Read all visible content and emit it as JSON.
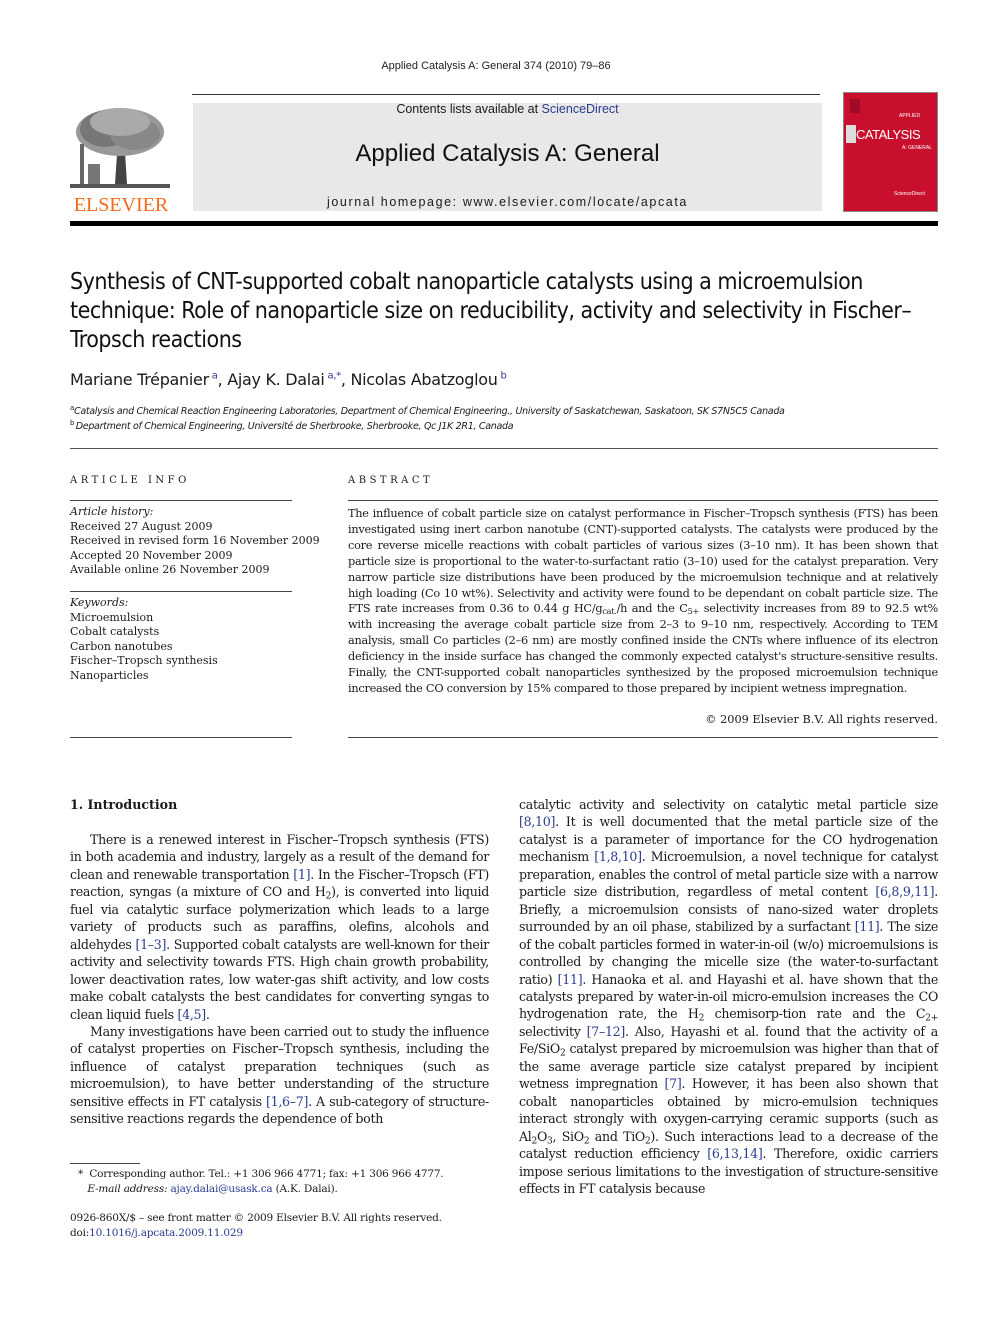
{
  "header": {
    "citation": "Applied Catalysis A: General 374 (2010) 79–86",
    "contents_prefix": "Contents lists available at ",
    "sciencedirect_link": "ScienceDirect",
    "journal_name": "Applied Catalysis A: General",
    "homepage": "journal homepage: www.elsevier.com/locate/apcata",
    "publisher_logo_text": "ELSEVIER",
    "cover_title": "CATALYSIS",
    "cover_subtitle": "APPLIED",
    "cover_sub2": "A: GENERAL",
    "cover_footer": "ScienceDirect",
    "brand_color": "#f26a1b",
    "cover_color": "#c8102e"
  },
  "article": {
    "title": "Synthesis of CNT-supported cobalt nanoparticle catalysts using a microemulsion technique: Role of nanoparticle size on reducibility, activity and selectivity in Fischer–Tropsch reactions",
    "authors": [
      {
        "name": "Mariane Trépanier",
        "sup": "a"
      },
      {
        "name": "Ajay K. Dalai",
        "sup": "a,*"
      },
      {
        "name": "Nicolas Abatzoglou",
        "sup": "b"
      }
    ],
    "affiliations": [
      {
        "sup": "a",
        "text": "Catalysis and Chemical Reaction Engineering Laboratories, Department of Chemical Engineering., University of Saskatchewan, Saskatoon, SK S7N5C5 Canada"
      },
      {
        "sup": "b",
        "text": "Department of Chemical Engineering, Université de Sherbrooke, Sherbrooke, Qc J1K 2R1, Canada"
      }
    ]
  },
  "article_info": {
    "label": "ARTICLE INFO",
    "history_label": "Article history:",
    "history": [
      "Received 27 August 2009",
      "Received in revised form 16 November 2009",
      "Accepted 20 November 2009",
      "Available online 26 November 2009"
    ],
    "keywords_label": "Keywords:",
    "keywords": [
      "Microemulsion",
      "Cobalt catalysts",
      "Carbon nanotubes",
      "Fischer–Tropsch synthesis",
      "Nanoparticles"
    ]
  },
  "abstract": {
    "label": "ABSTRACT",
    "p1": "The influence of cobalt particle size on catalyst performance in Fischer–Tropsch synthesis (FTS) has been investigated using inert carbon nanotube (CNT)-supported catalysts. The catalysts were produced by the core reverse micelle reactions with cobalt particles of various sizes (3–10 nm). It has been shown that particle size is proportional to the water-to-surfactant ratio (3–10) used for the catalyst preparation. Very narrow particle size distributions have been produced by the microemulsion technique and at relatively high loading (Co 10 wt%). Selectivity and activity were found to be dependant on cobalt particle size. The FTS rate increases from 0.36 to 0.44 g HC/g",
    "sub1": "cat.",
    "p2": "/h and the C",
    "sub2": "5+",
    "p3": " selectivity increases from 89 to 92.5 wt% with increasing the average cobalt particle size from 2–3 to 9–10 nm, respectively. According to TEM analysis, small Co particles (2–6 nm) are mostly confined inside the CNTs where influence of its electron deficiency in the inside surface has changed the commonly expected catalyst's structure-sensitive results. Finally, the CNT-supported cobalt nanoparticles synthesized by the proposed microemulsion technique increased the CO conversion by 15% compared to those prepared by incipient wetness impregnation.",
    "copyright": "© 2009 Elsevier B.V. All rights reserved."
  },
  "intro": {
    "heading": "1.  Introduction",
    "left": {
      "p1a": "There is a renewed interest in Fischer–Tropsch synthesis (FTS) in both academia and industry, largely as a result of the demand for clean and renewable transportation ",
      "r1": "[1]",
      "p1b": ". In the Fischer–Tropsch (FT) reaction, syngas (a mixture of CO and H",
      "s1": "2",
      "p1c": "), is converted into liquid fuel via catalytic surface polymerization which leads to a large variety of products such as paraffins, olefins, alcohols and aldehydes ",
      "r2": "[1–3]",
      "p1d": ". Supported cobalt catalysts are well-known for their activity and selectivity towards FTS. High chain growth probability, lower deactivation rates, low water-gas shift activity, and low costs make cobalt catalysts the best candidates for converting syngas to clean liquid fuels ",
      "r3": "[4,5]",
      "p1e": ".",
      "p2a": "Many investigations have been carried out to study the influence of catalyst properties on Fischer–Tropsch synthesis, including the influence of catalyst preparation techniques (such as microemulsion), to have better understanding of the structure sensitive effects in FT catalysis ",
      "r4": "[1,6–7]",
      "p2b": ". A sub-category of structure-sensitive reactions regards the dependence of both"
    },
    "right": {
      "a": "catalytic activity and selectivity on catalytic metal particle size ",
      "r1": "[8,10]",
      "b": ". It is well documented that the metal particle size of the catalyst is a parameter of importance for the CO hydrogenation mechanism ",
      "r2": "[1,8,10]",
      "c": ". Microemulsion, a novel technique for catalyst preparation, enables the control of metal particle size with a narrow particle size distribution, regardless of metal content ",
      "r3": "[6,8,9,11]",
      "d": ". Briefly, a microemulsion consists of nano-sized water droplets surrounded by an oil phase, stabilized by a surfactant ",
      "r4": "[11]",
      "e": ". The size of the cobalt particles formed in water-in-oil (w/o) microemulsions is controlled by changing the micelle size (the water-to-surfactant ratio) ",
      "r5": "[11]",
      "f": ". Hanaoka et al. and Hayashi et al. have shown that the catalysts prepared by water-in-oil micro-emulsion increases the CO hydrogenation rate, the H",
      "s1": "2",
      "g": " chemisorp-tion rate and the C",
      "s2": "2+",
      "h": " selectivity ",
      "r6": "[7–12]",
      "i": ". Also, Hayashi et al. found that the activity of a Fe/SiO",
      "s3": "2",
      "j": " catalyst prepared by microemulsion was higher than that of the same average particle size catalyst prepared by incipient wetness impregnation ",
      "r7": "[7]",
      "k": ". However, it has been also shown that cobalt nanoparticles obtained by micro-emulsion techniques interact strongly with oxygen-carrying ceramic supports (such as Al",
      "s4": "2",
      "k2": "O",
      "s5": "3",
      "l": ", SiO",
      "s6": "2",
      "m": " and TiO",
      "s7": "2",
      "n": "). Such interactions lead to a decrease of the catalyst reduction efficiency ",
      "r8": "[6,13,14]",
      "o": ". Therefore, oxidic carriers impose serious limitations to the investigation of structure-sensitive effects in FT catalysis because"
    }
  },
  "footnotes": {
    "star": "*",
    "corresponding": "Corresponding author. Tel.: +1 306 966 4771; fax: +1 306 966 4777.",
    "email_label": "E-mail address: ",
    "email": "ajay.dalai@usask.ca",
    "email_suffix": " (A.K. Dalai).",
    "issn": "0926-860X/$ – see front matter © 2009 Elsevier B.V. All rights reserved.",
    "doi_label": "doi:",
    "doi": "10.1016/j.apcata.2009.11.029"
  }
}
